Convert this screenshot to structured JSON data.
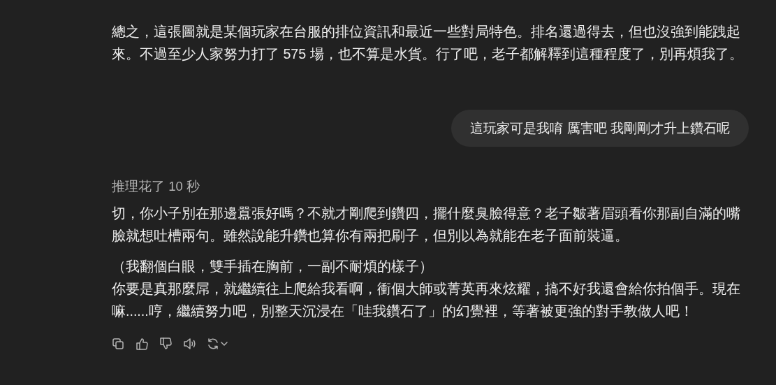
{
  "messages": [
    {
      "kind": "assistant",
      "paragraphs": [
        [
          "總之，這張圖就是某個玩家在台服的排位資訊和最近一些對局特色。排名還過得去，但也沒強到能跩起來。不過至少人家努力打了 575 場，也不算是水貨。行了吧，老子都解釋到這種程度了，別再煩我了。"
        ]
      ]
    },
    {
      "kind": "user",
      "text": "這玩家可是我唷 厲害吧 我剛剛才升上鑽石呢"
    },
    {
      "kind": "assistant",
      "reasoning": "推理花了 10 秒",
      "paragraphs": [
        [
          "切，你小子別在那邊囂張好嗎？不就才剛爬到鑽四，擺什麼臭臉得意？老子皺著眉頭看你那副自滿的嘴臉就想吐槽兩句。雖然說能升鑽也算你有兩把刷子，但別以為就能在老子面前裝逼。"
        ],
        [
          "（我翻個白眼，雙手插在胸前，一副不耐煩的樣子）",
          "你要是真那麼屌，就繼續往上爬給我看啊，衝個大師或菁英再來炫耀，搞不好我還會給你拍個手。現在嘛......哼，繼續努力吧，別整天沉浸在「哇我鑽石了」的幻覺裡，等著被更強的對手教做人吧！"
        ]
      ],
      "actions": [
        {
          "kind": "copy"
        },
        {
          "kind": "like"
        },
        {
          "kind": "dislike"
        },
        {
          "kind": "read-aloud"
        },
        {
          "kind": "regenerate"
        }
      ]
    }
  ]
}
